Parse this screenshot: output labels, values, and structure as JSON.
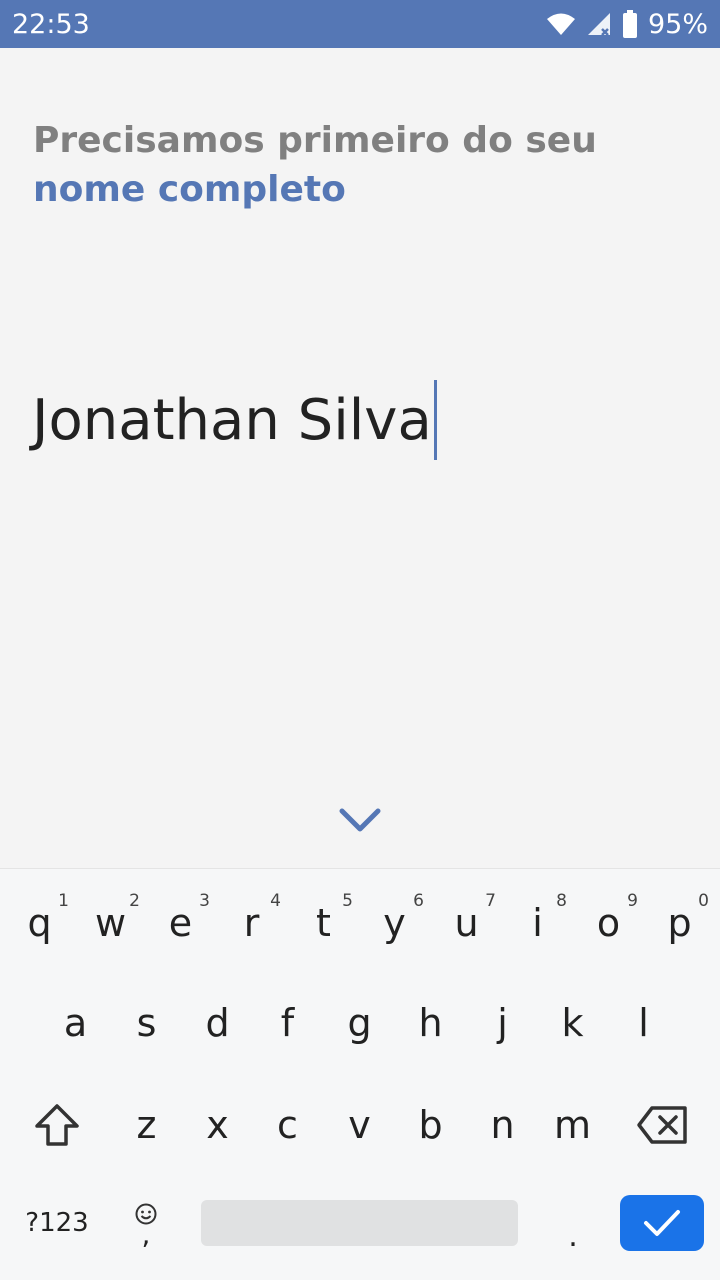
{
  "status_bar": {
    "time": "22:53",
    "battery_percent": "95%",
    "icons": [
      "wifi-icon",
      "signal-icon",
      "battery-icon"
    ],
    "color": "#5577b5"
  },
  "prompt": {
    "line1": "Precisamos primeiro do seu",
    "line2": "nome completo"
  },
  "name_input": {
    "value": "Jonathan Silva"
  },
  "keyboard": {
    "row1": [
      {
        "key": "q",
        "hint": "1"
      },
      {
        "key": "w",
        "hint": "2"
      },
      {
        "key": "e",
        "hint": "3"
      },
      {
        "key": "r",
        "hint": "4"
      },
      {
        "key": "t",
        "hint": "5"
      },
      {
        "key": "y",
        "hint": "6"
      },
      {
        "key": "u",
        "hint": "7"
      },
      {
        "key": "i",
        "hint": "8"
      },
      {
        "key": "o",
        "hint": "9"
      },
      {
        "key": "p",
        "hint": "0"
      }
    ],
    "row2": [
      "a",
      "s",
      "d",
      "f",
      "g",
      "h",
      "j",
      "k",
      "l"
    ],
    "row3": [
      "z",
      "x",
      "c",
      "v",
      "b",
      "n",
      "m"
    ],
    "symbols_label": "?123",
    "comma_label": ",",
    "period_label": ".",
    "accent_color": "#1a73e8"
  }
}
